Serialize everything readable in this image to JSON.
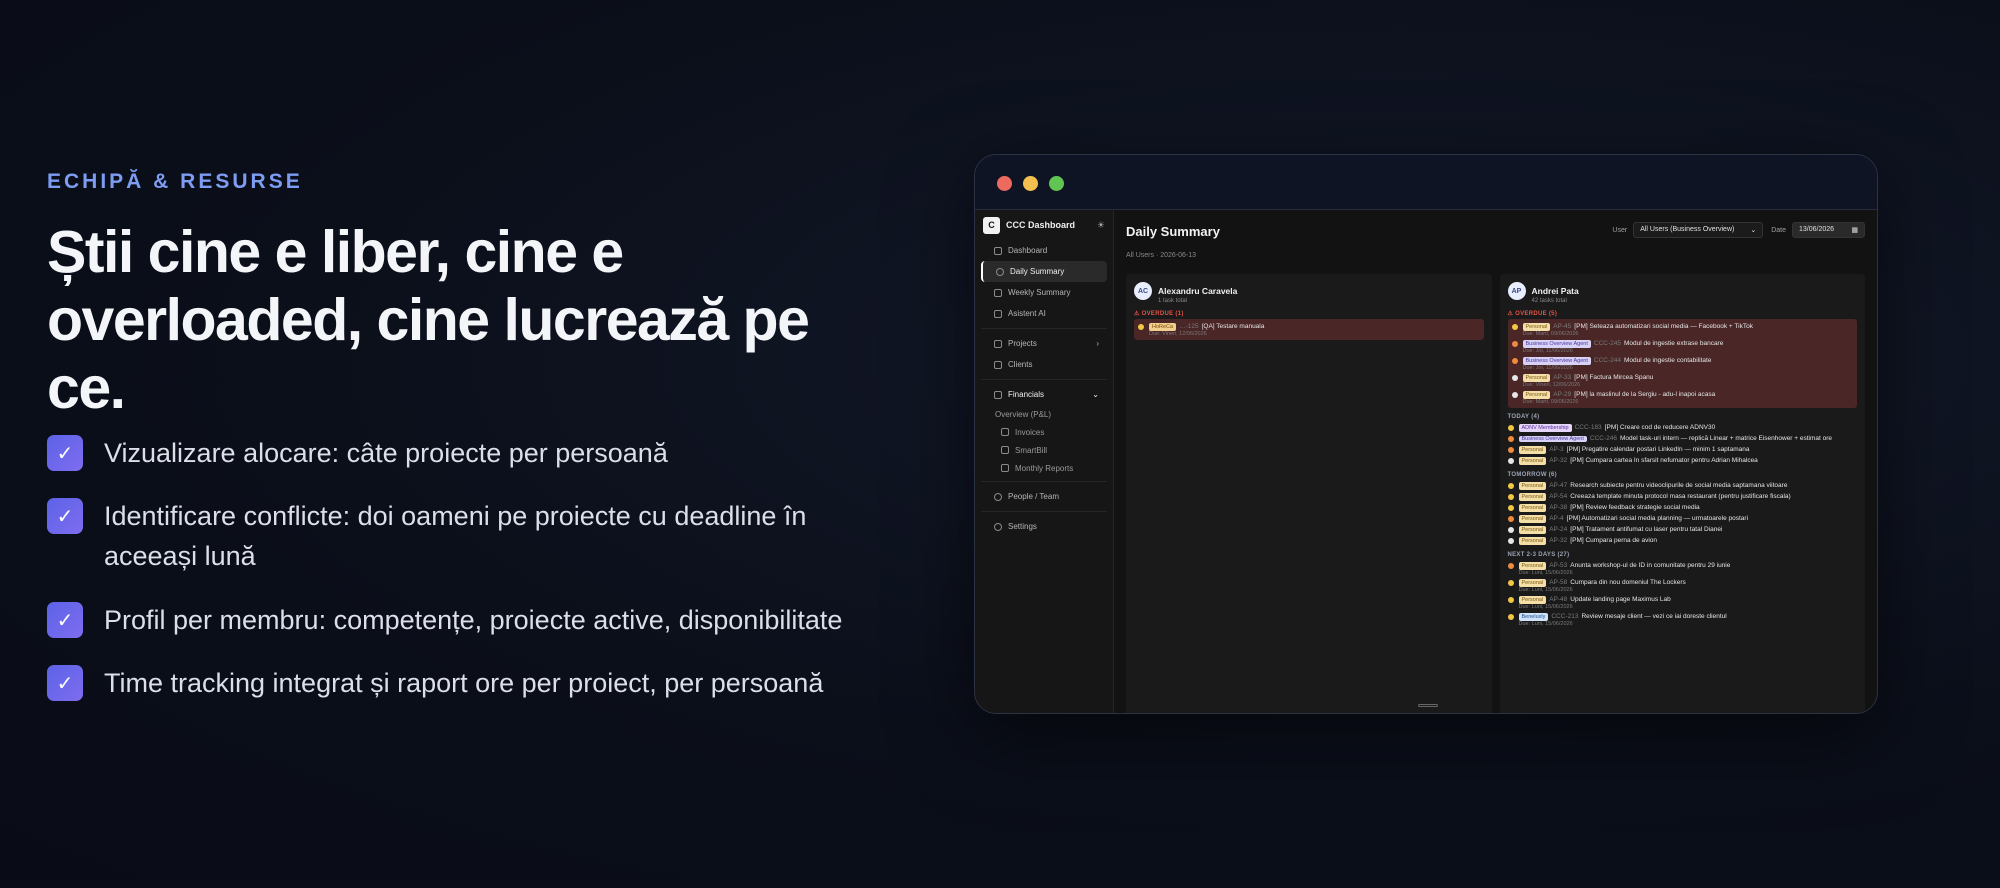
{
  "hero": {
    "eyebrow": "ECHIPĂ & RESURSE",
    "headline": "Știi cine e liber, cine e overloaded, cine lucrează pe ce.",
    "features": [
      "Vizualizare alocare: câte proiecte per persoană",
      "Identificare conflicte: doi oameni pe proiecte cu deadline în aceeași lună",
      "Profil per membru: competențe, proiecte active, disponibilitate",
      "Time tracking integrat și raport ore per proiect, per persoană"
    ],
    "check_glyph": "✓"
  },
  "colors": {
    "accent": "#7d9cf2",
    "check_start": "#5b63e6",
    "check_end": "#7f6cf0",
    "dot_red": "#ed6a5e",
    "dot_yellow": "#f4bf4f",
    "dot_green": "#61c554"
  },
  "app": {
    "brand_initial": "C",
    "brand_name": "CCC Dashboard",
    "sidebar": {
      "dashboard": "Dashboard",
      "daily": "Daily Summary",
      "weekly": "Weekly Summary",
      "assistant": "Asistent AI",
      "projects": "Projects",
      "clients": "Clients",
      "financials": "Financials",
      "overview": "Overview (P&L)",
      "invoices": "Invoices",
      "smartbill": "SmartBill",
      "reports": "Monthly Reports",
      "people": "People / Team",
      "settings": "Settings"
    },
    "title": "Daily Summary",
    "user_label": "User",
    "user_value": "All Users (Business Overview)",
    "date_label": "Date",
    "date_value": "13/06/2026",
    "subhead": "All Users · 2026-06-13",
    "col1": {
      "initials": "AC",
      "name": "Alexandru Caravela",
      "count": "1 task total",
      "overdue_label": "⚠ OVERDUE (1)",
      "tasks": [
        {
          "tag": "HoReCa",
          "code": "…-125",
          "title": "[QA] Testare manuala",
          "due": "Due: Vineri, 12/06/2026"
        }
      ]
    },
    "col2": {
      "initials": "AP",
      "name": "Andrei Pata",
      "count": "42 tasks total",
      "overdue_label": "⚠ OVERDUE (5)",
      "overdue": [
        {
          "tag": "Personal",
          "code": "AP-45",
          "title": "[PM] Seteaza automatizari social media — Facebook + TikTok",
          "due": "Due: Marti, 09/06/2026"
        },
        {
          "tag": "Business Overview Agent",
          "code": "CCC-245",
          "title": "Modul de ingestie extrase bancare",
          "due": "Due: Joi, 11/06/2026"
        },
        {
          "tag": "Business Overview Agent",
          "code": "CCC-244",
          "title": "Modul de ingestie contabilitate",
          "due": "Due: Joi, 11/06/2026"
        },
        {
          "tag": "Personal",
          "code": "AP-33",
          "title": "[PM] Factura Mircea Spanu",
          "due": "Due: Vineri, 12/06/2026"
        },
        {
          "tag": "Personal",
          "code": "AP-29",
          "title": "[PM] la maslinul de la Sergiu - adu-l inapoi acasa",
          "due": "Due: Marti, 09/06/2026"
        }
      ],
      "today_label": "TODAY (4)",
      "today": [
        {
          "tag": "ADNV Membership",
          "code": "CCC-183",
          "title": "[PM] Creare cod de reducere ADNV30"
        },
        {
          "tag": "Business Overview Agent",
          "code": "CCC-246",
          "title": "Model task-uri intern — replică Linear + matrice Eisenhower + estimat ore"
        },
        {
          "tag": "Personal",
          "code": "AP-3",
          "title": "[PM] Pregatire calendar postari LinkedIn — minim 1 saptamana"
        },
        {
          "tag": "Personal",
          "code": "AP-32",
          "title": "[PM] Cumpara cartea In sfarsit nefumator pentru Adrian Mihalcea"
        }
      ],
      "tomorrow_label": "TOMORROW (6)",
      "tomorrow": [
        {
          "tag": "Personal",
          "code": "AP-47",
          "title": "Research subiecte pentru videoclipurile de social media saptamana viitoare"
        },
        {
          "tag": "Personal",
          "code": "AP-54",
          "title": "Creeaza template minuta protocol masa restaurant (pentru justificare fiscala)"
        },
        {
          "tag": "Personal",
          "code": "AP-38",
          "title": "[PM] Review feedback strategie social media"
        },
        {
          "tag": "Personal",
          "code": "AP-4",
          "title": "[PM] Automatizari social media planning — urmatoarele postari"
        },
        {
          "tag": "Personal",
          "code": "AP-24",
          "title": "[PM] Tratament antifumat cu laser pentru tatal Dianei"
        },
        {
          "tag": "Personal",
          "code": "AP-32",
          "title": "[PM] Cumpara perna de avion"
        }
      ],
      "next_label": "NEXT 2-3 DAYS (27)",
      "next": [
        {
          "tag": "Personal",
          "code": "AP-53",
          "title": "Anunta workshop-ul de ID in comunitate pentru 29 iunie",
          "due": "Due: Luni, 15/06/2026"
        },
        {
          "tag": "Personal",
          "code": "AP-58",
          "title": "Cumpara din nou domeniul The Lockers",
          "due": "Due: Luni, 15/06/2026"
        },
        {
          "tag": "Personal",
          "code": "AP-48",
          "title": "Update landing page Maximus Lab",
          "due": "Due: Luni, 15/06/2026"
        },
        {
          "tag": "Beneluxly",
          "code": "CCC-213",
          "title": "Review mesaje client — vezi ce iai doreste clientul",
          "due": "Due: Luni, 15/06/2026"
        }
      ]
    }
  }
}
